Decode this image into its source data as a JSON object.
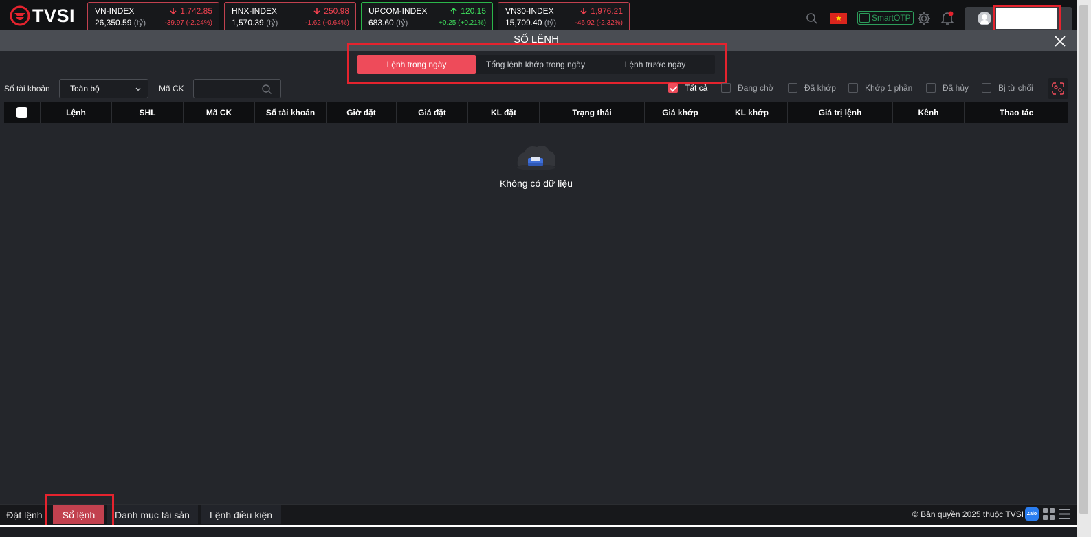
{
  "brand": {
    "name": "TVSI"
  },
  "indices": [
    {
      "name": "VN-INDEX",
      "price": "1,742.85",
      "volume": "26,350.59",
      "unit": "(tỷ)",
      "change": "-39.97  (-2.24%)",
      "direction": "down"
    },
    {
      "name": "HNX-INDEX",
      "price": "250.98",
      "volume": "1,570.39",
      "unit": "(tỷ)",
      "change": "-1.62  (-0.64%)",
      "direction": "down"
    },
    {
      "name": "UPCOM-INDEX",
      "price": "120.15",
      "volume": "683.60",
      "unit": "(tỷ)",
      "change": "+0.25  (+0.21%)",
      "direction": "up"
    },
    {
      "name": "VN30-INDEX",
      "price": "1,976.21",
      "volume": "15,709.40",
      "unit": "(tỷ)",
      "change": "-46.92  (-2.32%)",
      "direction": "down"
    }
  ],
  "header": {
    "otp_label": "SmartOTP",
    "flag_icon": "vietnam-flag-icon"
  },
  "modal": {
    "title": "SỐ LỆNH",
    "tabs": [
      "Lệnh trong ngày",
      "Tổng lệnh khớp trong ngày",
      "Lệnh trước ngày"
    ],
    "active_tab": 0
  },
  "filters": {
    "account_label": "Số tài khoản",
    "account_value": "Toàn bộ",
    "symbol_label": "Mã CK",
    "symbol_value": "",
    "status_options": [
      {
        "label": "Tất cả",
        "checked": true
      },
      {
        "label": "Đang chờ",
        "checked": false
      },
      {
        "label": "Đã khớp",
        "checked": false
      },
      {
        "label": "Khớp 1 phần",
        "checked": false
      },
      {
        "label": "Đã hủy",
        "checked": false
      },
      {
        "label": "Bị từ chối",
        "checked": false
      }
    ]
  },
  "table": {
    "columns": [
      "Lệnh",
      "SHL",
      "Mã CK",
      "Số tài khoản",
      "Giờ đặt",
      "Giá đặt",
      "KL đặt",
      "Trạng thái",
      "Giá khớp",
      "KL khớp",
      "Giá trị lệnh",
      "Kênh",
      "Thao tác"
    ],
    "rows": [],
    "empty_text": "Không có dữ liệu"
  },
  "footer": {
    "tabs": [
      "Đặt lệnh",
      "Sổ lệnh",
      "Danh mục tài sản",
      "Lệnh điều kiện"
    ],
    "active_tab": 1,
    "copyright": "© Bản quyền 2025 thuộc TVSI",
    "zalo_label": "Zalo"
  },
  "colors": {
    "accent": "#ee4b5a",
    "down": "#f0414f",
    "up": "#3ddc5b",
    "background": "#24262b"
  }
}
